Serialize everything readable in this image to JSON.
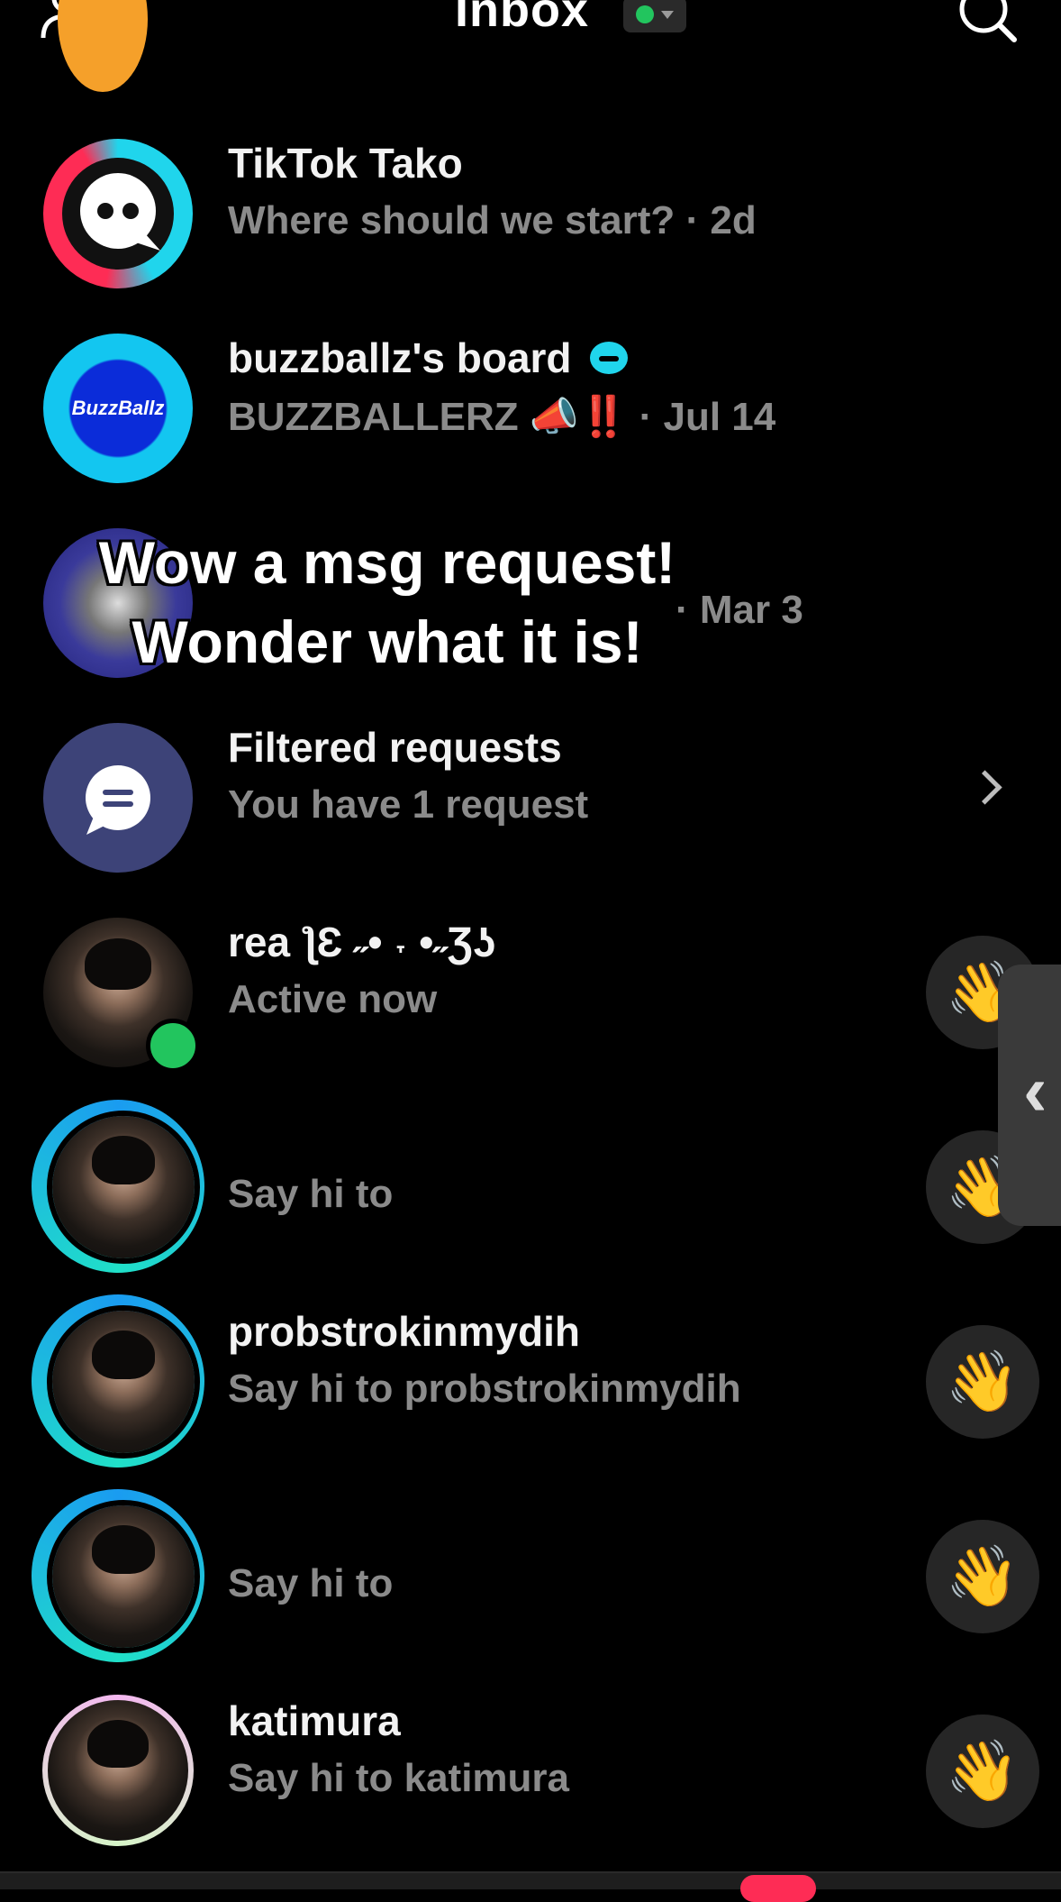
{
  "header": {
    "title": "Inbox",
    "add_friend_icon": "add-friend-icon",
    "search_icon": "search-icon",
    "status_color": "#22c55e"
  },
  "overlay_caption": {
    "line1": "Wow a msg request!",
    "line2": "Wonder what it is!"
  },
  "conversations": [
    {
      "name": "TikTok Tako",
      "subtitle": "Where should we start? · 2d"
    },
    {
      "name": "buzzballz's board",
      "subtitle": "BUZZBALLERZ 📣‼️ · Jul 14",
      "avatar_text": "BuzzBallz"
    },
    {
      "subtitle": "· Mar 3"
    }
  ],
  "filtered_requests": {
    "title": "Filtered requests",
    "subtitle": "You have 1 request"
  },
  "people": [
    {
      "name": "rea ƪƐ ˶• ˕ •˶Ʒʖ",
      "subtitle": "Active now",
      "wave": "👋"
    },
    {
      "name": "",
      "subtitle": "Say hi to",
      "wave": "👋"
    },
    {
      "name": "probstrokinmydih",
      "subtitle": "Say hi to probstrokinmydih",
      "wave": "👋"
    },
    {
      "name": "",
      "subtitle": "Say hi to",
      "wave": "👋"
    },
    {
      "name": "katimura",
      "subtitle": "Say hi to katimura",
      "wave": "👋"
    }
  ],
  "colors": {
    "background": "#000000",
    "primary_text": "#f2f2f2",
    "secondary_text": "#8b8b8b",
    "online": "#22c55e",
    "accent_cyan": "#20d5ec",
    "accent_red": "#fe2c55"
  }
}
